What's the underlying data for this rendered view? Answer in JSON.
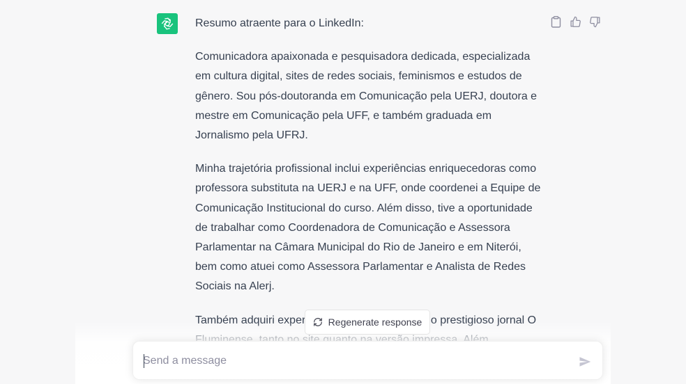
{
  "conversation": {
    "assistant_message": {
      "intro": "Resumo atraente para o LinkedIn:",
      "paragraphs": [
        "Comunicadora apaixonada e pesquisadora dedicada, especializada em cultura digital, sites de redes sociais, feminismos e estudos de gênero. Sou pós-doutoranda em Comunicação pela UERJ, doutora e mestre em Comunicação pela UFF, e também graduada em Jornalismo pela UFRJ.",
        "Minha trajetória profissional inclui experiências enriquecedoras como professora substituta na UERJ e na UFF, onde coordenei a Equipe de Comunicação Institucional do curso. Além disso, tive a oportunidade de trabalhar como Coordenadora de Comunicação e Assessora Parlamentar na Câmara Municipal do Rio de Janeiro e em Niterói, bem como atuei como Assessora Parlamentar e Analista de Redes Sociais na Alerj.",
        "Também adquiri exper                         olunista no prestigioso jornal O Fluminense, tanto no site quanto na versão impressa. Além"
      ]
    },
    "actions": {
      "copy_icon": "clipboard-icon",
      "like_icon": "thumbs-up-icon",
      "dislike_icon": "thumbs-down-icon"
    }
  },
  "regenerate": {
    "label": "Regenerate response",
    "icon": "refresh-icon"
  },
  "composer": {
    "placeholder": "Send a message",
    "value": "",
    "send_icon": "send-icon"
  },
  "colors": {
    "avatar_bg": "#19c37d",
    "page_bg": "#f7f7f8",
    "text": "#374151"
  }
}
